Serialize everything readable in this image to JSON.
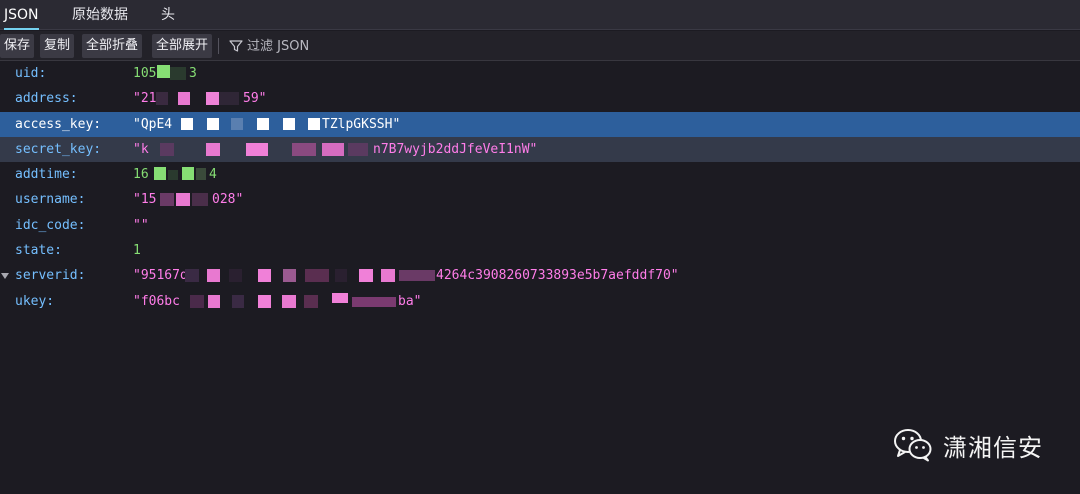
{
  "tabs": [
    {
      "label": "JSON"
    },
    {
      "label": "原始数据"
    },
    {
      "label": "头"
    }
  ],
  "toolbar": {
    "save_label": "保存",
    "copy_label": "复制",
    "collapse_all_label": "全部折叠",
    "expand_all_label": "全部展开",
    "filter_placeholder": "过滤 JSON"
  },
  "rows": [
    {
      "key": "uid:",
      "value": "105",
      "value_tail": "3",
      "type": "number"
    },
    {
      "key": "address:",
      "value": "\"21",
      "value_tail": "59\"",
      "type": "string"
    },
    {
      "key": "access_key:",
      "value": "\"QpE4",
      "value_tail": "TZlpGKSSH\"",
      "type": "string",
      "selected": true
    },
    {
      "key": "secret_key:",
      "value": "\"k",
      "value_tail": "n7B7wyjb2ddJfeVeI1nW\"",
      "type": "string",
      "hover": true
    },
    {
      "key": "addtime:",
      "value": "16",
      "value_tail": "4",
      "type": "number"
    },
    {
      "key": "username:",
      "value": "\"15",
      "value_tail": "028\"",
      "type": "string"
    },
    {
      "key": "idc_code:",
      "value": "\"\"",
      "value_tail": "",
      "type": "string"
    },
    {
      "key": "state:",
      "value": "1",
      "value_tail": "",
      "type": "number"
    },
    {
      "key": "serverid:",
      "value": "\"95167d",
      "value_tail": "4264c3908260733893e5b7aefddf70\"",
      "type": "string",
      "expandable": true
    },
    {
      "key": "ukey:",
      "value": "\"f06bc",
      "value_tail": "ba\"",
      "type": "string"
    }
  ],
  "watermark": {
    "text": "潇湘信安"
  },
  "colors": {
    "key": "#75bfff",
    "string": "#ff7de9",
    "number": "#86de74",
    "selection": "#2d5f9c",
    "background": "#1c1b22"
  }
}
